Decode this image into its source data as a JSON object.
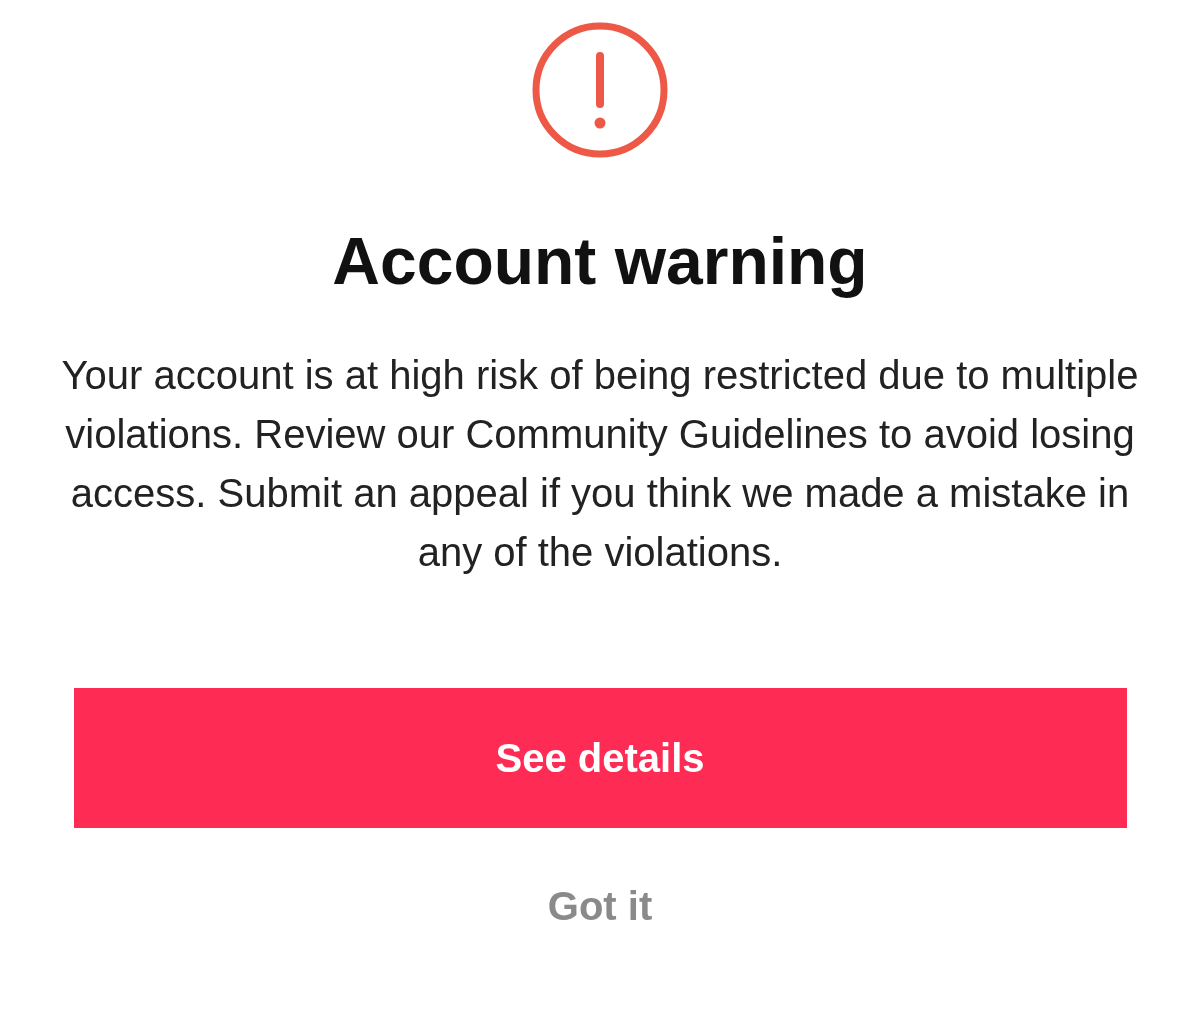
{
  "dialog": {
    "title": "Account warning",
    "message": "Your account is at high risk of being restricted due to multiple violations. Review our Community Guidelines to avoid losing access. Submit an appeal if you think we made a mistake in any of the violations.",
    "buttons": [
      {
        "label": "See details",
        "kind": "primary"
      },
      {
        "label": "Got it",
        "kind": "secondary"
      }
    ]
  }
}
